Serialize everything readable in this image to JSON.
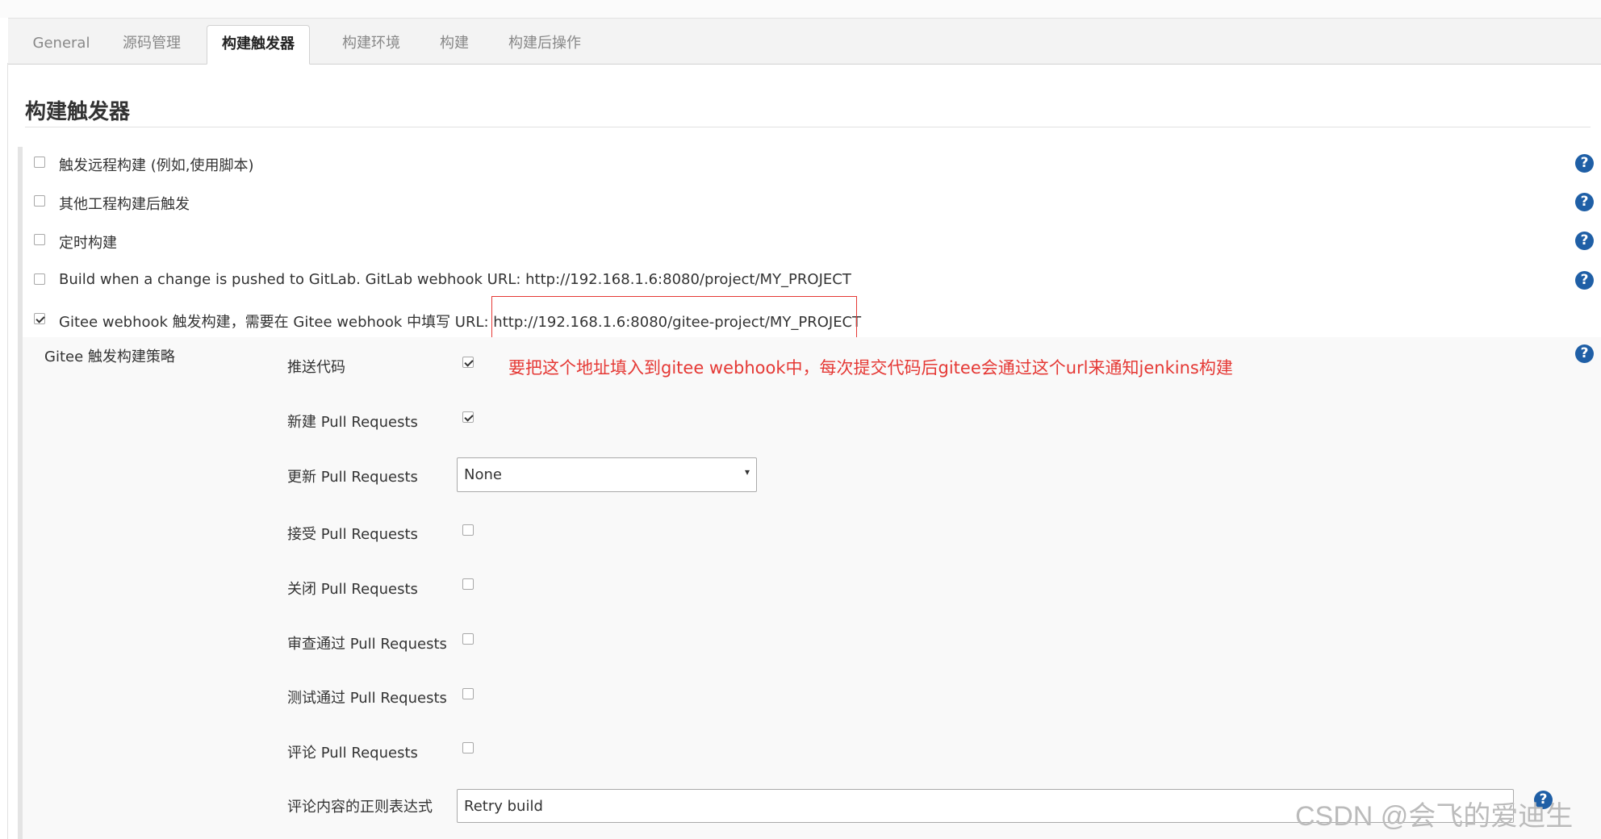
{
  "tabs": [
    {
      "label": "General",
      "active": false
    },
    {
      "label": "源码管理",
      "active": false
    },
    {
      "label": "构建触发器",
      "active": true
    },
    {
      "label": "构建环境",
      "active": false
    },
    {
      "label": "构建",
      "active": false
    },
    {
      "label": "构建后操作",
      "active": false
    }
  ],
  "section_title": "构建触发器",
  "triggers": [
    {
      "label": "触发远程构建 (例如,使用脚本)",
      "checked": false
    },
    {
      "label": "其他工程构建后触发",
      "checked": false
    },
    {
      "label": "定时构建",
      "checked": false
    },
    {
      "label": "Build when a change is pushed to GitLab. GitLab webhook URL: http://192.168.1.6:8080/project/MY_PROJECT",
      "checked": false
    },
    {
      "label_prefix": "Gitee webhook 触发构建，需要在 Gitee webhook 中填写 URL: ",
      "url": "http://192.168.1.6:8080/gitee-project/MY_PROJECT",
      "checked": true
    }
  ],
  "strategy": {
    "title": "Gitee 触发构建策略",
    "push_label": "推送代码",
    "push_checked": true,
    "new_pr_label": "新建 Pull Requests",
    "new_pr_checked": true,
    "update_pr_label": "更新 Pull Requests",
    "update_pr_value": "None",
    "accept_pr_label": "接受 Pull Requests",
    "accept_pr_checked": false,
    "close_pr_label": "关闭 Pull Requests",
    "close_pr_checked": false,
    "approve_pr_label": "审查通过 Pull Requests",
    "approve_pr_checked": false,
    "test_pr_label": "测试通过 Pull Requests",
    "test_pr_checked": false,
    "comment_pr_label": "评论 Pull Requests",
    "comment_pr_checked": false,
    "comment_regex_label": "评论内容的正则表达式",
    "comment_regex_value": "Retry build"
  },
  "annotation": "要把这个地址填入到gitee  webhook中，每次提交代码后gitee会通过这个url来通知jenkins构建",
  "help_symbol": "?",
  "select_arrow": "▾",
  "watermark": "CSDN @会飞的爱迪生",
  "colors": {
    "accent_red": "#e53935",
    "help_blue": "#1f5fa6"
  }
}
